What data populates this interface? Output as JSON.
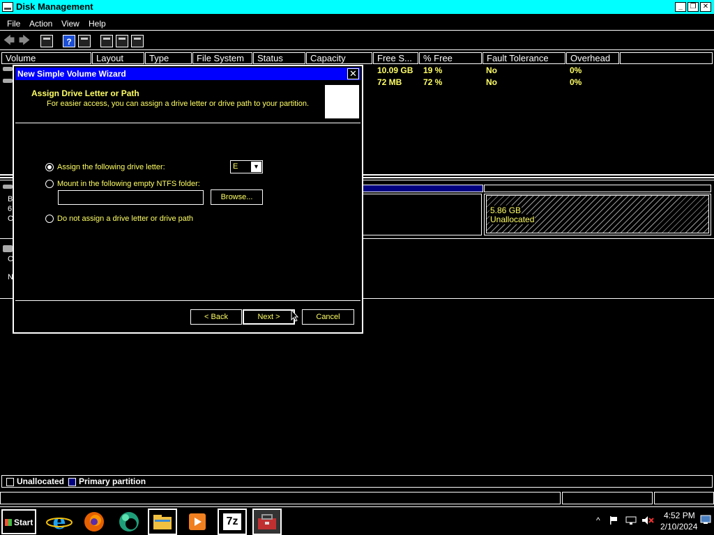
{
  "window": {
    "title": "Disk Management",
    "minimize": "_",
    "restore": "❐",
    "close": "✕"
  },
  "menu": {
    "file": "File",
    "action": "Action",
    "view": "View",
    "help": "Help"
  },
  "toolbar": {
    "back": "🡄",
    "forward": "🡆",
    "help": "?"
  },
  "columns": {
    "volume": "Volume",
    "layout": "Layout",
    "type": "Type",
    "file_system": "File System",
    "status": "Status",
    "capacity": "Capacity",
    "free_space": "Free S...",
    "pct_free": "% Free",
    "fault_tolerance": "Fault Tolerance",
    "overhead": "Overhead"
  },
  "volumes": [
    {
      "free_space": "10.09 GB",
      "pct_free": "19 %",
      "fault_tolerance": "No",
      "overhead": "0%"
    },
    {
      "free_space": "72 MB",
      "pct_free": "72 %",
      "fault_tolerance": "No",
      "overhead": "0%"
    }
  ],
  "disk0": {
    "label_b": "B",
    "label_6": "6",
    "label_o": "O",
    "unallocated_size": "5.86 GB",
    "unallocated_label": "Unallocated"
  },
  "disk1": {
    "label_c": "C",
    "label_n": "N"
  },
  "legend": {
    "unallocated": "Unallocated",
    "primary": "Primary partition",
    "primary_color": "#000080"
  },
  "wizard": {
    "title": "New Simple Volume Wizard",
    "close": "✕",
    "heading": "Assign Drive Letter or Path",
    "subheading": "For easier access, you can assign a drive letter or drive path to your partition.",
    "opt_assign": "Assign the following drive letter:",
    "opt_mount": "Mount in the following empty NTFS folder:",
    "opt_none": "Do not assign a drive letter or drive path",
    "drive_letter": "E",
    "folder_value": "",
    "browse": "Browse...",
    "back": "< Back",
    "next": "Next >",
    "cancel": "Cancel",
    "selected_option": "assign"
  },
  "taskbar": {
    "start": "Start",
    "apps": [
      "internet-explorer",
      "firefox",
      "edge",
      "file-explorer",
      "media-player",
      "7-zip",
      "computer-management"
    ],
    "seven_zip_label": "7z",
    "tray_chevron": "^",
    "time": "4:52 PM",
    "date": "2/10/2024"
  }
}
